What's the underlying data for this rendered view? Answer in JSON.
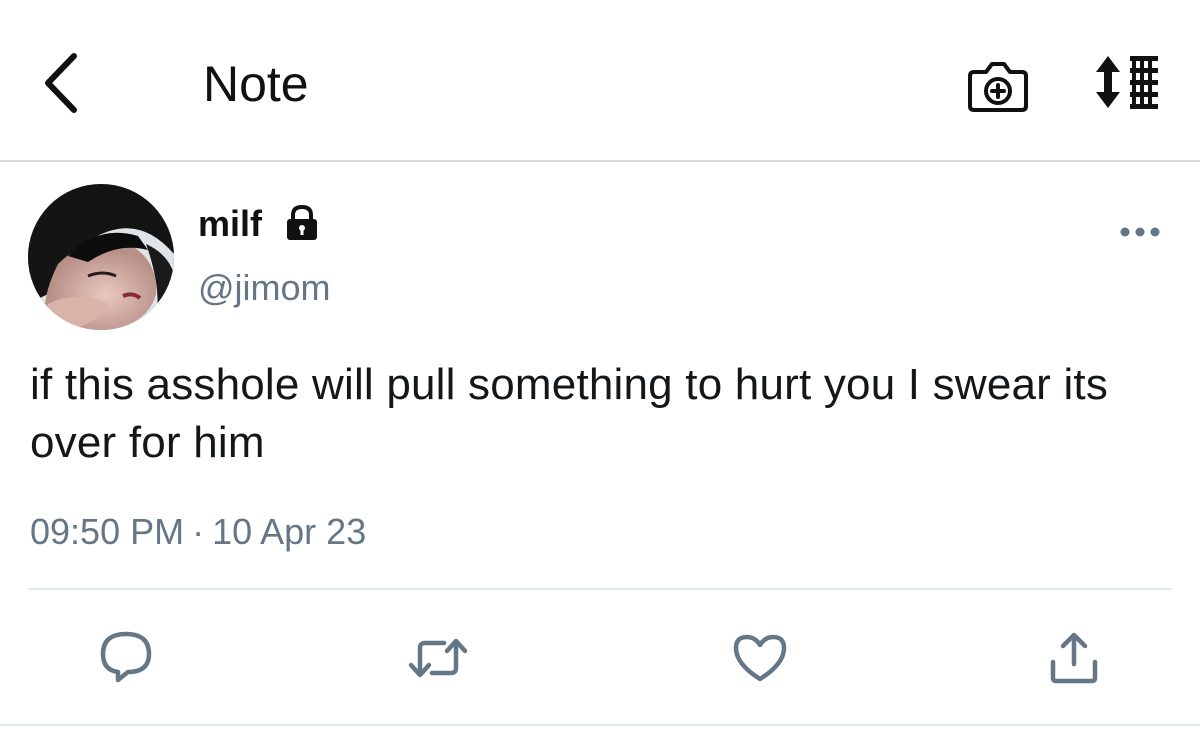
{
  "header": {
    "title": "Note",
    "back_icon": "chevron-left-icon",
    "camera_icon": "camera-add-icon",
    "sort_icon": "sort-list-icon"
  },
  "tweet": {
    "display_name": "milf",
    "protected_icon": "lock-icon",
    "handle": "@jimom",
    "more_icon": "more-horizontal-icon",
    "text": "if this asshole will pull something to hurt you I swear its over for him",
    "time": "09:50 PM",
    "separator": "·",
    "date": "10 Apr 23"
  },
  "actions": {
    "reply_icon": "reply-icon",
    "retweet_icon": "retweet-icon",
    "like_icon": "heart-icon",
    "share_icon": "share-icon"
  },
  "colors": {
    "text_primary": "#14171a",
    "text_secondary": "#657786",
    "icon_gray": "#657786",
    "divider": "#e1e8ed"
  }
}
